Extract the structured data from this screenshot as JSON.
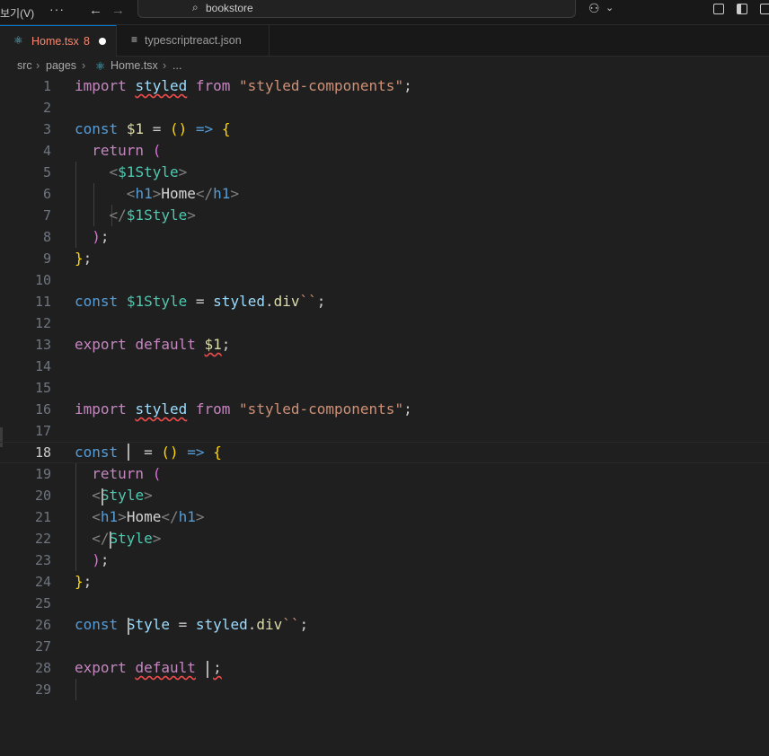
{
  "titlebar": {
    "menu_view": "보기(V)",
    "more": "···",
    "back_icon": "←",
    "forward_icon": "→",
    "search_icon": "⌕",
    "search_text": "bookstore",
    "copilot_icon": "⚇",
    "copilot_chevron": "⌄"
  },
  "tabs": {
    "active": {
      "icon": "⚛",
      "label": "Home.tsx",
      "problems": "8"
    },
    "inactive": {
      "icon": "≡",
      "label": "typescriptreact.json"
    }
  },
  "breadcrumb": {
    "src": "src",
    "sep1": "›",
    "pages": "pages",
    "sep2": "›",
    "file_icon": "⚛",
    "file": "Home.tsx",
    "sep3": "›",
    "tail": "..."
  },
  "editor": {
    "lines": [
      {
        "n": "1"
      },
      {
        "n": "2"
      },
      {
        "n": "3"
      },
      {
        "n": "4"
      },
      {
        "n": "5"
      },
      {
        "n": "6"
      },
      {
        "n": "7"
      },
      {
        "n": "8"
      },
      {
        "n": "9"
      },
      {
        "n": "10"
      },
      {
        "n": "11"
      },
      {
        "n": "12"
      },
      {
        "n": "13"
      },
      {
        "n": "14"
      },
      {
        "n": "15"
      },
      {
        "n": "16"
      },
      {
        "n": "17"
      },
      {
        "n": "18"
      },
      {
        "n": "19"
      },
      {
        "n": "20"
      },
      {
        "n": "21"
      },
      {
        "n": "22"
      },
      {
        "n": "23"
      },
      {
        "n": "24"
      },
      {
        "n": "25"
      },
      {
        "n": "26"
      },
      {
        "n": "27"
      },
      {
        "n": "28"
      },
      {
        "n": "29"
      }
    ],
    "tok": {
      "import": "import",
      "styled": "styled",
      "from": "from",
      "pkg": "\"styled-components\"",
      "semi": ";",
      "const": "const",
      "s1": "$1",
      "eq": "=",
      "paren_open": "(",
      "paren_close": ")",
      "arrow": "=>",
      "brace_open": "{",
      "brace_close": "}",
      "return": "return",
      "lt": "<",
      "gt": ">",
      "lt_slash": "</",
      "s1style": "$1Style",
      "h1": "h1",
      "home": "Home",
      "paren_semi_close": ")",
      "brace_semi": "};",
      "dot": ".",
      "div": "div",
      "backticks": "``",
      "export": "export",
      "default": "default",
      "style_S": "S",
      "style_rest": "tyle",
      "style": "Style"
    }
  }
}
